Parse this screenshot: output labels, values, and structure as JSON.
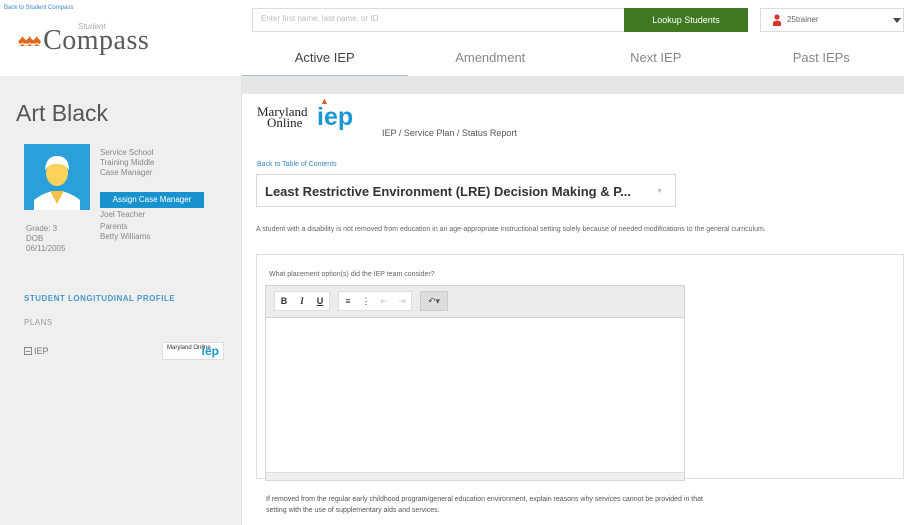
{
  "header": {
    "back_link": "Back to Student Compass",
    "logo_student": "Student",
    "logo_compass": "Compass",
    "search_placeholder": "Enter first name, last name, or ID",
    "lookup_button": "Lookup Students",
    "user_name": "25trainer",
    "user_icon": "person-icon",
    "tabs": [
      {
        "label": "Active IEP",
        "active": true
      },
      {
        "label": "Amendment",
        "active": false
      },
      {
        "label": "Next IEP",
        "active": false
      },
      {
        "label": "Past IEPs",
        "active": false
      }
    ]
  },
  "sidebar": {
    "student_name": "Art Black",
    "service_school_label": "Service School",
    "service_school_value": "Training Middle",
    "case_manager_label": "Case Manager",
    "assign_button": "Assign Case Manager",
    "case_manager_value": "Joel Teacher",
    "parents_label": "Parents",
    "parents_value": "Betty Williams",
    "grade": "Grade: 3",
    "dob_label": "DOB",
    "dob_value": "06/11/2005",
    "longitudinal_profile": "STUDENT LONGITUDINAL PROFILE",
    "plans_label": "PLANS",
    "iep_item": "IEP",
    "mini_logo_text": "Maryland Online",
    "mini_logo_iep": "iep"
  },
  "main": {
    "logo_maryland": "Maryland",
    "logo_online": "Online",
    "logo_iep": "iep",
    "doc_title": "IEP / Service Plan / Status Report",
    "toc_link": "Back to Table of Contents",
    "section_select": "Least Restrictive Environment (LRE) Decision Making & P...",
    "lre_statement": "A student with a disability is not removed from education in an age-appropriate instructional setting solely because of needed modifications to the general curriculum.",
    "question1": "What placement option(s) did the IEP team consider?",
    "editor_value": "",
    "question2": "If removed from the regular early childhood program/general education environment, explain reasons why services cannot be provided in that setting with the use of supplementary aids and services."
  },
  "colors": {
    "accent_blue": "#1893cf",
    "lookup_green": "#3f7a23",
    "user_red": "#d9342b",
    "logo_orange": "#e06a1b"
  }
}
